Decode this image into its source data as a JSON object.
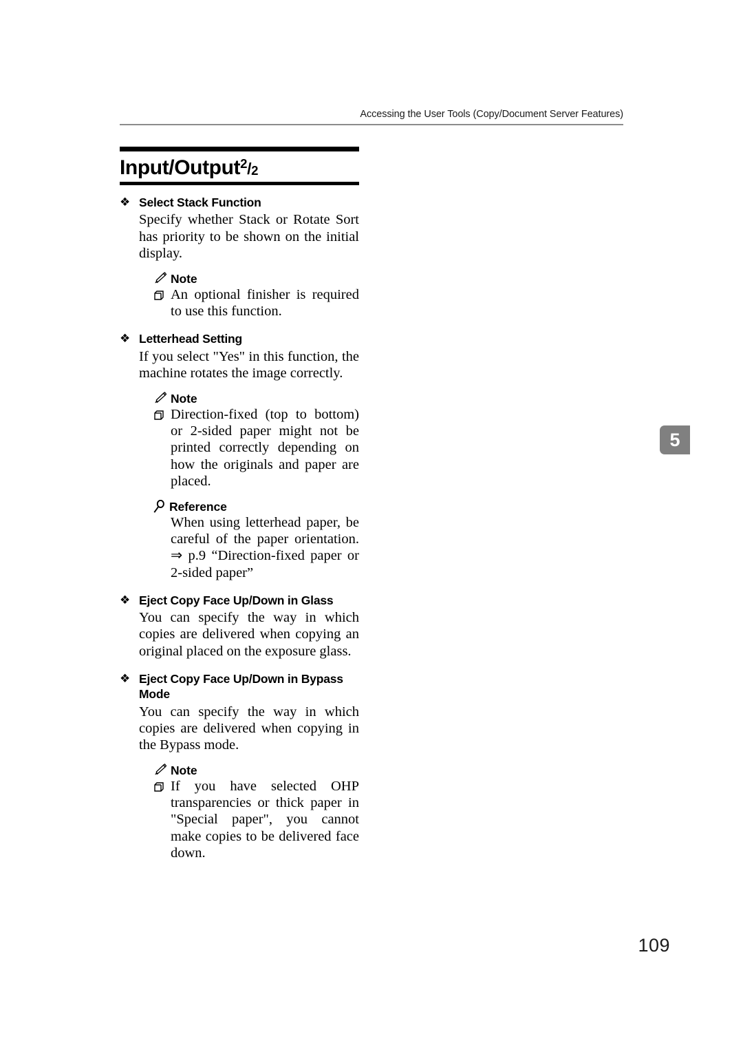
{
  "header": {
    "running_head": "Accessing the User Tools (Copy/Document Server Features)"
  },
  "chapter_tab": {
    "number": "5"
  },
  "title": {
    "main": "Input/Output",
    "fraction_numerator": "2",
    "fraction_slash": "/",
    "fraction_denominator": "2"
  },
  "icons": {
    "diamond_bullet": "diamond-bullet-icon",
    "note": "pencil-icon",
    "reference": "magnifier-icon",
    "note_item": "box-marker-icon"
  },
  "labels": {
    "note": "Note",
    "reference": "Reference"
  },
  "sections": [
    {
      "heading": "Select Stack Function",
      "body": "Specify whether Stack or Rotate Sort has priority to be shown on the initial display.",
      "note_items": [
        "An optional finisher is required to use this function."
      ]
    },
    {
      "heading": "Letterhead Setting",
      "body": "If you select \"Yes\" in this function, the machine rotates the image correctly.",
      "note_items": [
        "Direction-fixed (top to bottom) or 2-sided paper might not be printed correctly depending on how the originals and paper are placed."
      ],
      "reference_text": "When using letterhead paper, be careful of the paper orientation. ⇒ p.9 “Direction-fixed paper or 2-sided paper”"
    },
    {
      "heading": "Eject Copy Face Up/Down in Glass",
      "body": "You can specify the way in which copies are delivered when copying an original placed on the exposure glass."
    },
    {
      "heading": "Eject Copy Face Up/Down in Bypass Mode",
      "body": "You can specify the way in which copies are delivered when copying in the Bypass mode.",
      "note_items": [
        "If you have selected OHP transparencies or thick paper in \"Special paper\", you cannot make copies to be delivered face down."
      ]
    }
  ],
  "folio": {
    "page_number": "109"
  },
  "colors": {
    "text": "#000000",
    "header_rule": "#8c8c8c",
    "chapter_tab_bg": "#808080",
    "title_rule": "#000000"
  }
}
